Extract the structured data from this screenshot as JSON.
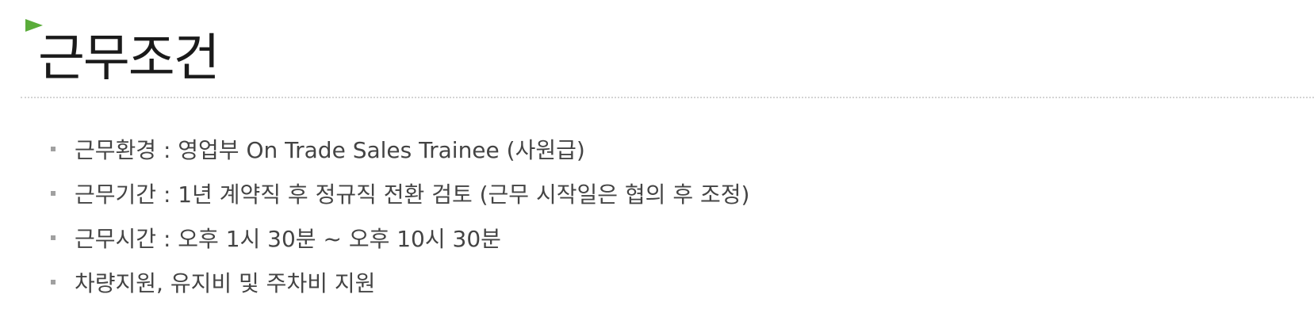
{
  "section": {
    "title": "근무조건"
  },
  "icons": {
    "title_marker": "green-triangle-arrow-icon",
    "bullet": "square-bullet-icon"
  },
  "colors": {
    "marker": "#5aac3a",
    "title": "#1a1a1a",
    "text": "#444444",
    "divider": "#d4d4d4",
    "bullet": "#a0a0a0"
  },
  "conditions": [
    "근무환경 : 영업부 On Trade Sales Trainee (사원급)",
    "근무기간 : 1년 계약직 후 정규직 전환 검토 (근무 시작일은 협의 후 조정)",
    "근무시간 : 오후 1시 30분 ~ 오후 10시 30분",
    "차량지원, 유지비 및 주차비 지원"
  ]
}
